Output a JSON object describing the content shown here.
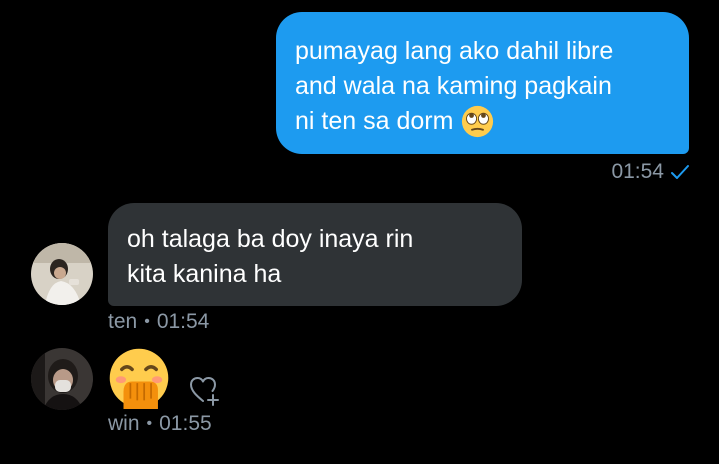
{
  "messages": [
    {
      "direction": "outgoing",
      "text_lines": [
        "pumayag lang ako dahil libre",
        "and wala na kaming pagkain",
        "ni ten sa dorm"
      ],
      "emoji": "rolling-eyes-emoji",
      "time": "01:54",
      "status_icon": "checkmark-icon"
    },
    {
      "direction": "incoming",
      "sender": "ten",
      "text_lines": [
        "oh talaga ba doy inaya rin",
        "kita kanina ha"
      ],
      "time": "01:54",
      "separator": "•"
    },
    {
      "direction": "incoming",
      "sender": "win",
      "emoji": "hand-over-mouth-emoji",
      "reaction_icon": "heart-add-icon",
      "time": "01:55",
      "separator": "•"
    }
  ],
  "colors": {
    "background": "#000000",
    "outgoing_bubble": "#1d9bf0",
    "incoming_bubble": "#2f3336",
    "meta_text": "#8b98a5",
    "checkmark": "#1d9bf0"
  }
}
